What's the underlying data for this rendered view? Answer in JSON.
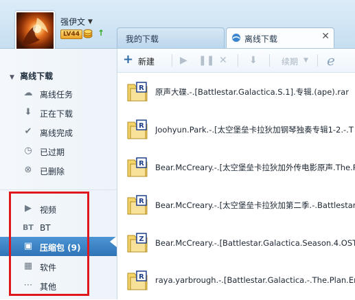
{
  "user": {
    "name": "强伊文",
    "level": "LV44"
  },
  "tabs": [
    {
      "label": "我的下载"
    },
    {
      "label": "离线下载"
    }
  ],
  "toolbar": {
    "new_label": "新建",
    "resume_label": "续期"
  },
  "sidebar": {
    "section_title": "离线下载",
    "items": [
      {
        "label": "离线任务",
        "icon": "cloud-icon"
      },
      {
        "label": "正在下载",
        "icon": "download-arrow-icon"
      },
      {
        "label": "离线完成",
        "icon": "check-icon"
      },
      {
        "label": "已过期",
        "icon": "clock-icon"
      },
      {
        "label": "已删除",
        "icon": "deleted-icon"
      }
    ],
    "categories": [
      {
        "label": "视频",
        "icon": "video-icon"
      },
      {
        "label": "BT",
        "icon": "bt-icon"
      },
      {
        "label": "压缩包 (9)",
        "icon": "archive-icon",
        "active": true
      },
      {
        "label": "软件",
        "icon": "software-grid-icon"
      },
      {
        "label": "其他",
        "icon": "more-dots-icon"
      }
    ]
  },
  "files": [
    {
      "name": "原声大碟.-.[Battlestar.Galactica.S.1].专辑.(ape).rar",
      "badge": "R"
    },
    {
      "name": "Joohyun.Park.-.[太空堡垒卡拉狄加钢琴独奏专辑1-2.-.T",
      "badge": "R"
    },
    {
      "name": "Bear.McCreary.-.[太空堡垒卡拉狄加外传电影原声.The.P",
      "badge": "R"
    },
    {
      "name": "Bear.McCreary.-.[太空堡垒卡拉狄加第二季.-.Battlestar.G",
      "badge": "R"
    },
    {
      "name": "Bear.McCreary.-.[Battlestar.Galactica.Season.4.OST].专辑",
      "badge": "Z"
    },
    {
      "name": "raya.yarbrough.-.[Battlestar.Galactica.-.The.Plan.End.Tit",
      "badge": "R"
    }
  ],
  "colors": {
    "accent": "#2e74b7",
    "highlight_box": "#e0161d"
  }
}
